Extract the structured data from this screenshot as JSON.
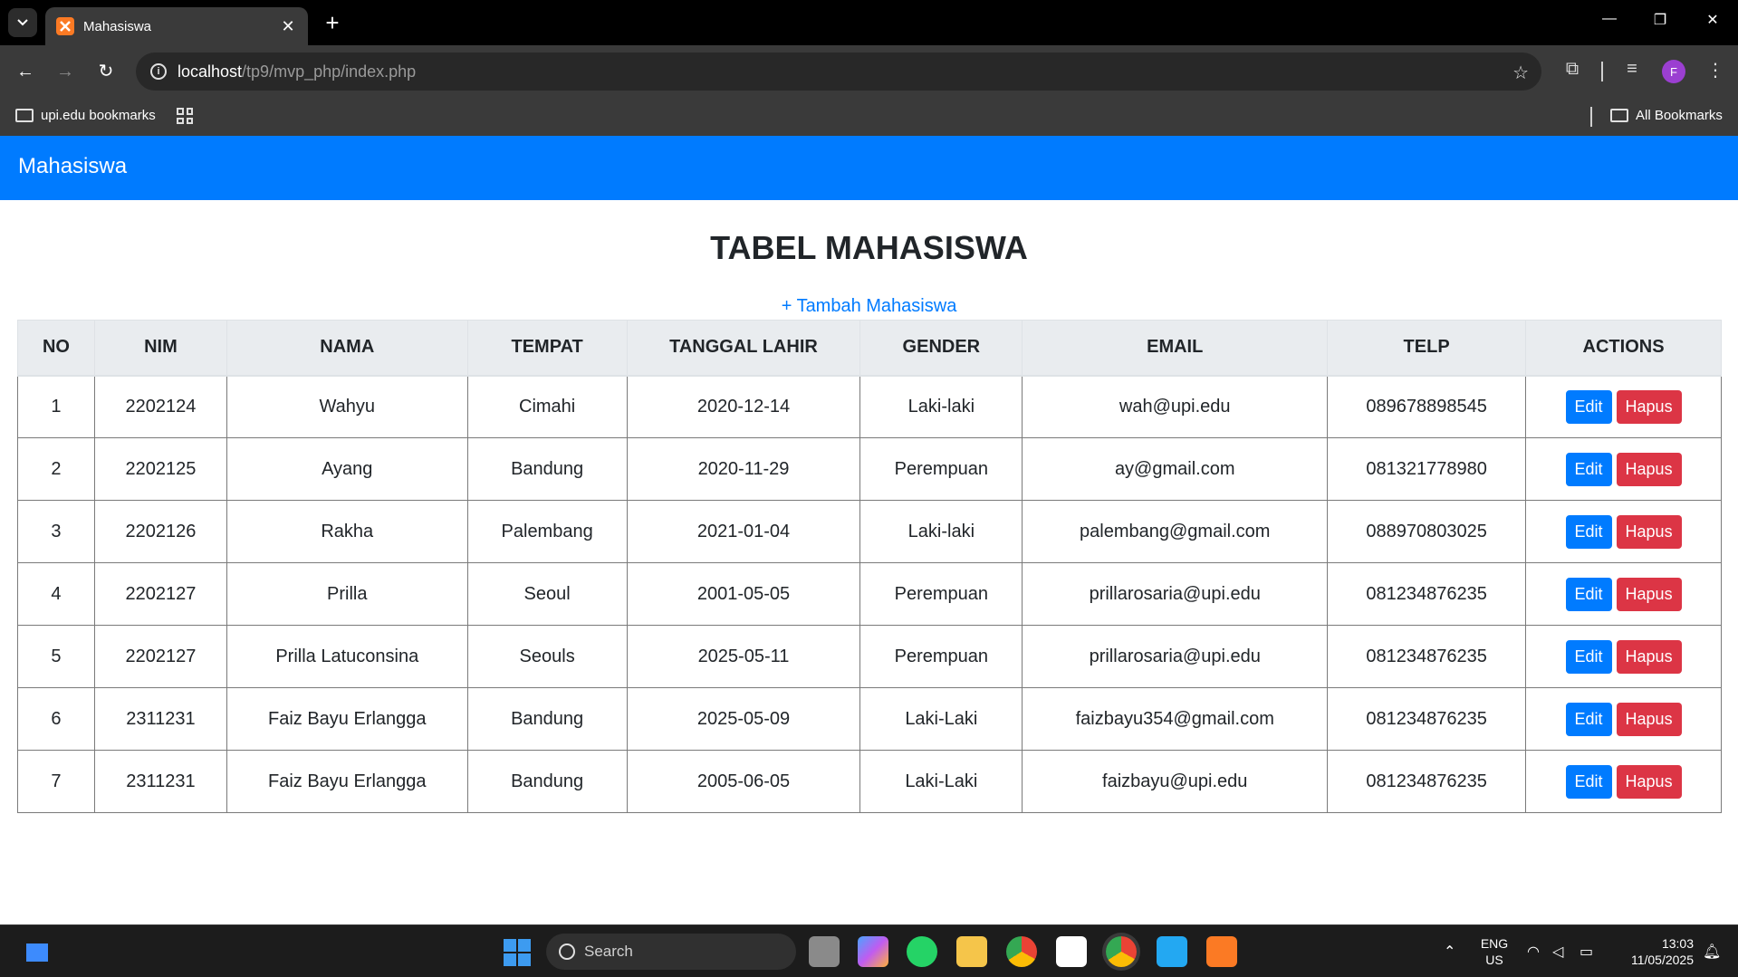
{
  "browser": {
    "tab_title": "Mahasiswa",
    "url_host": "localhost",
    "url_path": "/tp9/mvp_php/index.php",
    "profile_initial": "F",
    "bookmarks": {
      "left_folder": "upi.edu bookmarks",
      "right_folder": "All Bookmarks"
    }
  },
  "page": {
    "brand": "Mahasiswa",
    "heading": "TABEL MAHASISWA",
    "add_link": "+ Tambah Mahasiswa",
    "table": {
      "headers": [
        "NO",
        "NIM",
        "NAMA",
        "TEMPAT",
        "TANGGAL LAHIR",
        "GENDER",
        "EMAIL",
        "TELP",
        "ACTIONS"
      ],
      "rows": [
        {
          "no": "1",
          "nim": "2202124",
          "nama": "Wahyu",
          "tempat": "Cimahi",
          "tanggal_lahir": "2020-12-14",
          "gender": "Laki-laki",
          "email": "wah@upi.edu",
          "telp": "089678898545"
        },
        {
          "no": "2",
          "nim": "2202125",
          "nama": "Ayang",
          "tempat": "Bandung",
          "tanggal_lahir": "2020-11-29",
          "gender": "Perempuan",
          "email": "ay@gmail.com",
          "telp": "081321778980"
        },
        {
          "no": "3",
          "nim": "2202126",
          "nama": "Rakha",
          "tempat": "Palembang",
          "tanggal_lahir": "2021-01-04",
          "gender": "Laki-laki",
          "email": "palembang@gmail.com",
          "telp": "088970803025"
        },
        {
          "no": "4",
          "nim": "2202127",
          "nama": "Prilla",
          "tempat": "Seoul",
          "tanggal_lahir": "2001-05-05",
          "gender": "Perempuan",
          "email": "prillarosaria@upi.edu",
          "telp": "081234876235"
        },
        {
          "no": "5",
          "nim": "2202127",
          "nama": "Prilla Latuconsina",
          "tempat": "Seouls",
          "tanggal_lahir": "2025-05-11",
          "gender": "Perempuan",
          "email": "prillarosaria@upi.edu",
          "telp": "081234876235"
        },
        {
          "no": "6",
          "nim": "2311231",
          "nama": "Faiz Bayu Erlangga",
          "tempat": "Bandung",
          "tanggal_lahir": "2025-05-09",
          "gender": "Laki-Laki",
          "email": "faizbayu354@gmail.com",
          "telp": "081234876235"
        },
        {
          "no": "7",
          "nim": "2311231",
          "nama": "Faiz Bayu Erlangga",
          "tempat": "Bandung",
          "tanggal_lahir": "2005-06-05",
          "gender": "Laki-Laki",
          "email": "faizbayu@upi.edu",
          "telp": "081234876235"
        }
      ],
      "edit_label": "Edit",
      "delete_label": "Hapus"
    }
  },
  "taskbar": {
    "search_placeholder": "Search",
    "language": "ENG",
    "region": "US",
    "time": "13:03",
    "date": "11/05/2025"
  },
  "colors": {
    "primary": "#007bff",
    "danger": "#dc3545",
    "header_bg": "#e9ecef"
  }
}
